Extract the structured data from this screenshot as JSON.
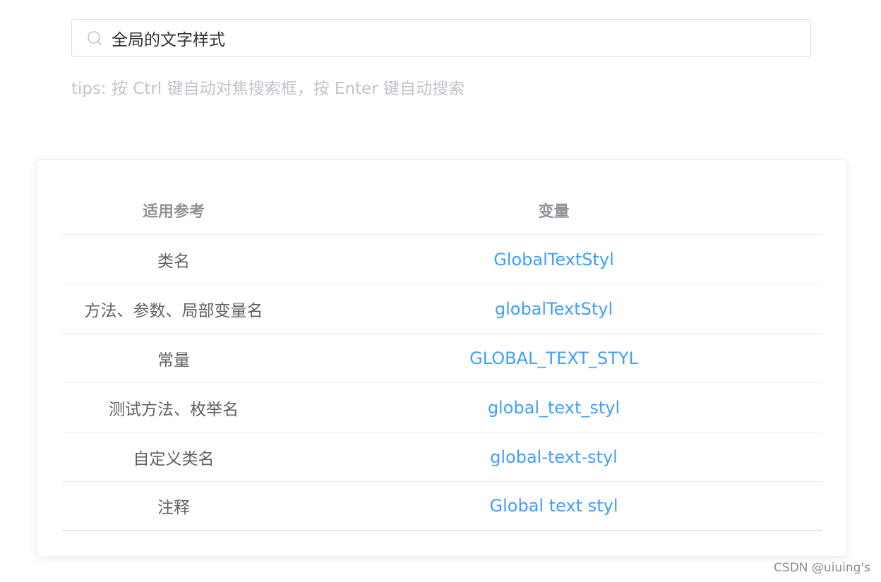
{
  "search": {
    "value": "全局的文字样式",
    "icon": "search-icon"
  },
  "tips": "tips: 按 Ctrl 键自动对焦搜索框，按 Enter 键自动搜索",
  "table": {
    "headers": [
      "适用参考",
      "变量"
    ],
    "rows": [
      {
        "ref": "类名",
        "var": "GlobalTextStyl"
      },
      {
        "ref": "方法、参数、局部变量名",
        "var": "globalTextStyl"
      },
      {
        "ref": "常量",
        "var": "GLOBAL_TEXT_STYL"
      },
      {
        "ref": "测试方法、枚举名",
        "var": "global_text_styl"
      },
      {
        "ref": "自定义类名",
        "var": "global-text-styl"
      },
      {
        "ref": "注释",
        "var": "Global text styl"
      }
    ]
  },
  "watermark": "CSDN @uiuing's",
  "colors": {
    "accent": "#409eff",
    "header_text": "#909399",
    "body_text": "#606266",
    "tips_text": "#c0c4cc"
  }
}
